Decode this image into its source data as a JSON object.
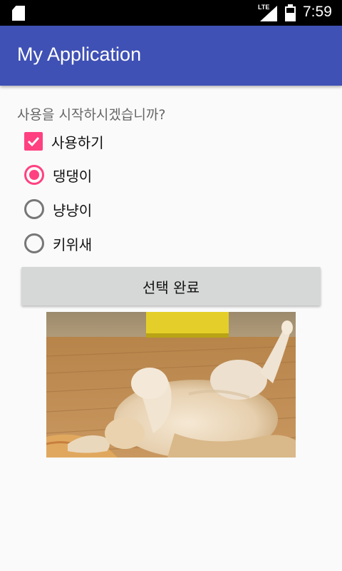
{
  "status_bar": {
    "network": "LTE",
    "time": "7:59"
  },
  "app_bar": {
    "title": "My Application",
    "color": "#3f51b5"
  },
  "content": {
    "question": "사용을 시작하시겠습니까?",
    "checkbox": {
      "label": "사용하기",
      "checked": true
    },
    "radio_options": [
      {
        "label": "댕댕이",
        "checked": true
      },
      {
        "label": "냥냥이",
        "checked": false
      },
      {
        "label": "키위새",
        "checked": false
      }
    ],
    "done_button": "선택 완료",
    "accent": "#ff4081"
  }
}
